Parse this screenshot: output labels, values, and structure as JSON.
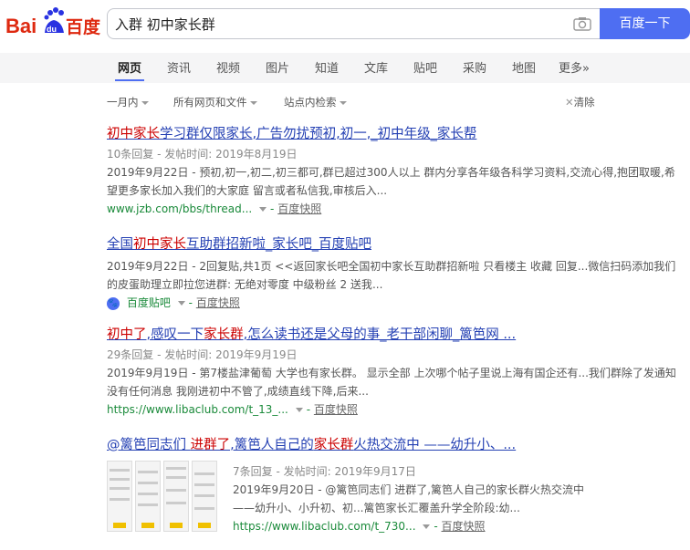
{
  "logo": {
    "left_text": "Bai",
    "du_text": "du",
    "right_text": "百度"
  },
  "search": {
    "value": "入群 初中家长群",
    "button": "百度一下"
  },
  "tabs": [
    "网页",
    "资讯",
    "视频",
    "图片",
    "知道",
    "文库",
    "贴吧",
    "采购",
    "地图",
    "更多»"
  ],
  "filters": {
    "time": "一月内",
    "type": "所有网页和文件",
    "site": "站点内检索",
    "clear": "清除"
  },
  "results": [
    {
      "title_parts": [
        [
          "初中家长",
          "hl"
        ],
        [
          "学习群仅限",
          ""
        ],
        [
          "家长",
          ""
        ],
        [
          ",广告勿扰预初,初一,_初中年级_家长帮",
          ""
        ]
      ],
      "meta": "10条回复 - 发帖时间: 2019年8月19日",
      "abstract": "2019年9月22日 - 预初,初一,初二,初三都可,群已超过300人以上 群内分享各年级各科学习资料,交流心得,抱团取暖,希望更多家长加入我们的大家庭 留言或者私信我,审核后入...",
      "url": "www.jzb.com/bbs/thread...",
      "snapshot": "百度快照"
    },
    {
      "title_parts": [
        [
          "全国",
          ""
        ],
        [
          "初中家长",
          "hl"
        ],
        [
          "互助群招新啦_家长吧_百度贴吧",
          ""
        ]
      ],
      "meta": "",
      "abstract": "2019年9月22日 - 2回复贴,共1页 <<返回家长吧全国初中家长互助群招新啦 只看楼主 收藏 回复...微信扫码添加我们的皮蛋助理立即拉您进群: 无绝对零度 中级粉丝 2 送我...",
      "url": "百度贴吧",
      "snapshot": "百度快照"
    },
    {
      "title_parts": [
        [
          "初中了",
          "hl"
        ],
        [
          ",感叹一下",
          ""
        ],
        [
          "家长群",
          "hl"
        ],
        [
          ",怎么读书还是父母的事_老干部闲聊_篱笆网 ...",
          ""
        ]
      ],
      "meta": "29条回复 - 发帖时间: 2019年9月19日",
      "abstract": "2019年9月19日 - 第7楼盐津葡萄 大学也有家长群。 显示全部 上次哪个帖子里说上海有国企还有...我们群除了发通知没有任何消息 我刚进初中不管了,成绩直线下降,后来...",
      "url": "https://www.libaclub.com/t_13_...",
      "snapshot": "百度快照"
    },
    {
      "title_parts": [
        [
          "@篱笆同志们 ",
          ""
        ],
        [
          "进群了",
          "hl"
        ],
        [
          ",篱笆人自己的",
          ""
        ],
        [
          "家长群",
          "hl"
        ],
        [
          "火热交流中 ——幼升小、...",
          ""
        ]
      ],
      "meta": "7条回复 - 发帖时间: 2019年9月17日",
      "abstract": "2019年9月20日 - @篱笆同志们 进群了,篱笆人自己的家长群火热交流中 ——幼升小、小升初、初...篱笆家长汇覆盖升学全阶段:幼...",
      "url": "https://www.libaclub.com/t_730...",
      "snapshot": "百度快照"
    }
  ],
  "colors": {
    "brand_blue": "#4e6ef2",
    "brand_red": "#de2910",
    "link": "#2440b3",
    "highlight": "#cc0000",
    "url_green": "#1a8a3a"
  }
}
